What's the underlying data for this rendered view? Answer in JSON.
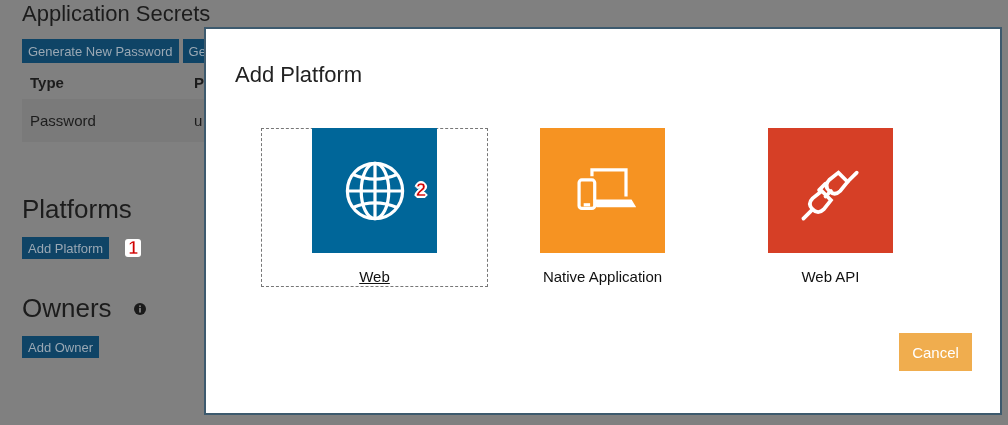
{
  "page": {
    "title": "Application Secrets",
    "secret_buttons": [
      "Generate New Password",
      "Ge"
    ],
    "table": {
      "columns": [
        "Type",
        "P"
      ],
      "rows": [
        [
          "Password",
          "u"
        ]
      ]
    },
    "sections": [
      {
        "title": "Platforms",
        "button": "Add Platform",
        "step": "1",
        "info": false
      },
      {
        "title": "Owners",
        "button": "Add Owner",
        "info": true
      }
    ]
  },
  "dialog": {
    "title": "Add Platform",
    "platforms": [
      {
        "label": "Web",
        "kind": "globe",
        "color": "#006699",
        "selected": true,
        "step": "2"
      },
      {
        "label": "Native Application",
        "kind": "devices",
        "color": "#f69322",
        "selected": false
      },
      {
        "label": "Web API",
        "kind": "plug",
        "color": "#d63f26",
        "selected": false
      }
    ],
    "cancel": "Cancel"
  }
}
